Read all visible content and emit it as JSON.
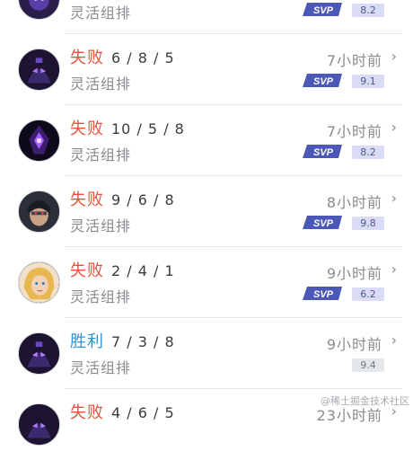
{
  "matches": [
    {
      "result": "",
      "result_type": "loss",
      "kda": "",
      "mode": "灵活组排",
      "time": "",
      "svp": true,
      "score": "8.2",
      "score_style": "purple",
      "hero_icon": "hero-purple-avatar"
    },
    {
      "result": "失败",
      "result_type": "loss",
      "kda": "6 / 8 / 5",
      "mode": "灵活组排",
      "time": "7小时前",
      "svp": true,
      "score": "9.1",
      "score_style": "purple",
      "hero_icon": "hero-purple-mask-avatar"
    },
    {
      "result": "失败",
      "result_type": "loss",
      "kda": "10 / 5 / 8",
      "mode": "灵活组排",
      "time": "7小时前",
      "svp": true,
      "score": "8.2",
      "score_style": "purple",
      "hero_icon": "hero-violet-flame-avatar"
    },
    {
      "result": "失败",
      "result_type": "loss",
      "kda": "9 / 6 / 8",
      "mode": "灵活组排",
      "time": "8小时前",
      "svp": true,
      "score": "9.8",
      "score_style": "purple",
      "hero_icon": "hero-dark-hunter-avatar"
    },
    {
      "result": "失败",
      "result_type": "loss",
      "kda": "2 / 4 / 1",
      "mode": "灵活组排",
      "time": "9小时前",
      "svp": true,
      "score": "6.2",
      "score_style": "purple",
      "hero_icon": "hero-blonde-avatar"
    },
    {
      "result": "胜利",
      "result_type": "win",
      "kda": "7 / 3 / 8",
      "mode": "灵活组排",
      "time": "9小时前",
      "svp": false,
      "score": "9.4",
      "score_style": "grey",
      "hero_icon": "hero-purple-mask-avatar"
    },
    {
      "result": "失败",
      "result_type": "loss",
      "kda": "4 / 6 / 5",
      "mode": "",
      "time": "23小时前",
      "svp": false,
      "score": "",
      "score_style": "purple",
      "hero_icon": "hero-purple-mask-avatar"
    }
  ],
  "chevron": "›",
  "svp_label": "SVP",
  "watermark": "@稀土掘金技术社区",
  "colors": {
    "loss": "#e6533c",
    "win": "#2e95d3",
    "svp": "#4c58b8",
    "score_bg": "#d9dcf4"
  }
}
